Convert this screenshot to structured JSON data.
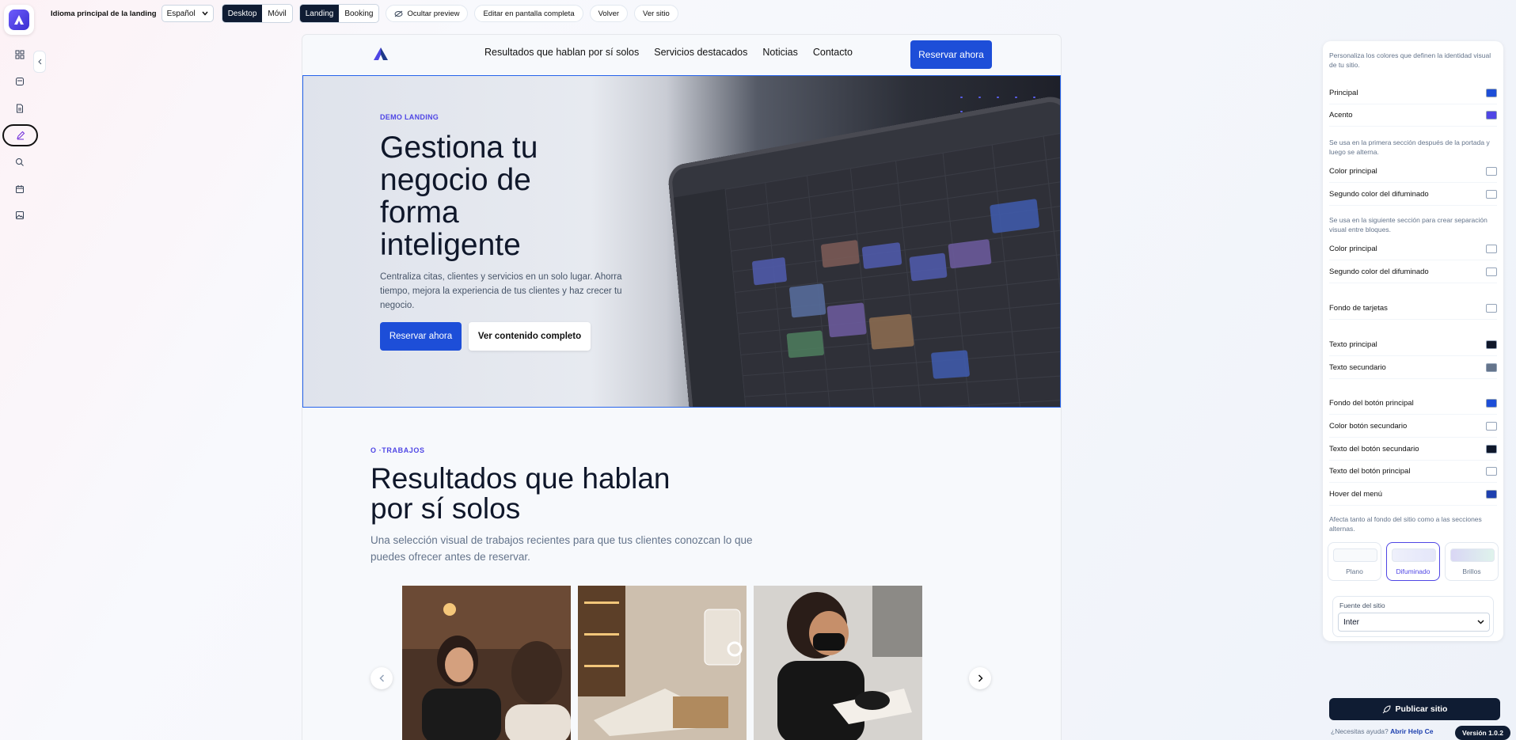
{
  "topbar": {
    "lang_label": "Idioma principal de la landing",
    "lang_value": "Español",
    "device_desktop": "Desktop",
    "device_mobile": "Móvil",
    "mode_landing": "Landing",
    "mode_booking": "Booking",
    "hide_preview": "Ocultar preview",
    "fullscreen": "Editar en pantalla completa",
    "back": "Volver",
    "view_site": "Ver sitio"
  },
  "sidebar": {
    "icons": [
      "grid-icon",
      "layers-icon",
      "file-icon",
      "edit-icon",
      "search-icon",
      "calendar-icon",
      "image-icon"
    ],
    "active": "edit-icon"
  },
  "preview": {
    "nav": {
      "links": [
        "Resultados que hablan por sí solos",
        "Servicios destacados",
        "Noticias",
        "Contacto"
      ],
      "cta": "Reservar ahora"
    },
    "hero": {
      "label": "DEMO LANDING",
      "title": "Gestiona tu negocio de forma inteligente",
      "subtitle": "Centraliza citas, clientes y servicios en un solo lugar. Ahorra tiempo, mejora la experiencia de tus clientes y haz crecer tu negocio.",
      "primary_btn": "Reservar ahora",
      "secondary_btn": "Ver contenido completo"
    },
    "section": {
      "label": "O ·TRABAJOS",
      "title": "Resultados que hablan por sí solos",
      "subtitle": "Una selección visual de trabajos recientes para que tus clientes conozcan lo que puedes ofrecer antes de reservar."
    }
  },
  "panel": {
    "intro": "Personaliza los colores que definen la identidad visual de tu sitio.",
    "brand_colors": [
      {
        "label": "Principal",
        "color": "#1d4ed8"
      },
      {
        "label": "Acento",
        "color": "#4f46e5"
      }
    ],
    "note_first": "Se usa en la primera sección después de la portada y luego se alterna.",
    "first_section": [
      {
        "label": "Color principal",
        "color": "#ffffff"
      },
      {
        "label": "Segundo color del difuminado",
        "color": "#ffffff"
      }
    ],
    "note_next": "Se usa en la siguiente sección para crear separación visual entre bloques.",
    "next_section": [
      {
        "label": "Color principal",
        "color": "#ffffff"
      },
      {
        "label": "Segundo color del difuminado",
        "color": "#ffffff"
      }
    ],
    "cards_bg": {
      "label": "Fondo de tarjetas",
      "color": "#ffffff"
    },
    "text_colors": [
      {
        "label": "Texto principal",
        "color": "#0f172a"
      },
      {
        "label": "Texto secundario",
        "color": "#64748b"
      }
    ],
    "button_colors": [
      {
        "label": "Fondo del botón principal",
        "color": "#1d4ed8"
      },
      {
        "label": "Color botón secundario",
        "color": "#ffffff"
      },
      {
        "label": "Texto del botón secundario",
        "color": "#0f172a"
      },
      {
        "label": "Texto del botón principal",
        "color": "#ffffff"
      },
      {
        "label": "Hover del menú",
        "color": "#1e40af"
      }
    ],
    "note_bg": "Afecta tanto al fondo del sitio como a las secciones alternas.",
    "bg_options": [
      "Plano",
      "Difuminado",
      "Brillos"
    ],
    "bg_selected": "Difuminado",
    "font_label": "Fuente del sitio",
    "font_value": "Inter"
  },
  "footer": {
    "publish": "Publicar sitio",
    "help_prefix": "¿Necesitas ayuda?",
    "help_link": "Abrir Help Ce",
    "version": "Versión 1.0.2"
  }
}
